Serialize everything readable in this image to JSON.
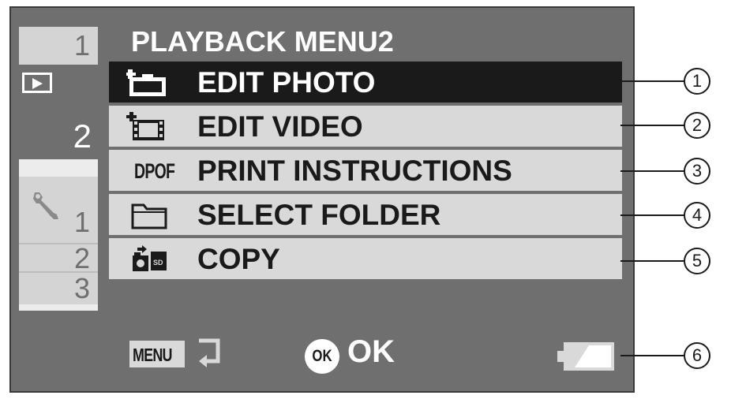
{
  "menu": {
    "title": "PLAYBACK MENU2",
    "items": [
      {
        "label": "EDIT PHOTO",
        "icon": "edit-photo-icon",
        "selected": true
      },
      {
        "label": "EDIT VIDEO",
        "icon": "edit-video-icon",
        "selected": false
      },
      {
        "label": "PRINT INSTRUCTIONS",
        "icon": "dpof-icon",
        "icon_text": "DPOF",
        "selected": false
      },
      {
        "label": "SELECT FOLDER",
        "icon": "folder-icon",
        "selected": false
      },
      {
        "label": "COPY",
        "icon": "copy-icon",
        "selected": false
      }
    ]
  },
  "tabs": {
    "playback": [
      "1",
      "2"
    ],
    "settings": [
      "1",
      "2",
      "3"
    ]
  },
  "bottom": {
    "menu_button": "MENU",
    "ok_button": "OK",
    "ok_label": "OK"
  },
  "callouts": [
    "1",
    "2",
    "3",
    "4",
    "5",
    "6"
  ],
  "colors": {
    "screen_bg": "#6f6f6f",
    "item_bg": "#d9d9d9",
    "selected_bg": "#1a1a1a",
    "text_light": "#ffffff"
  }
}
